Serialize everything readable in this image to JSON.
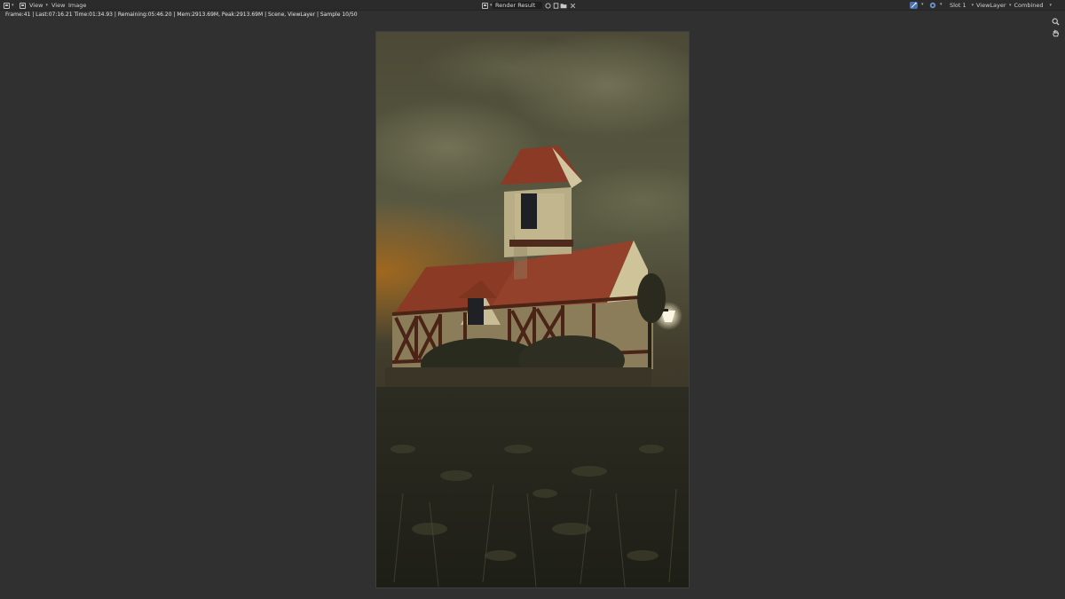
{
  "header": {
    "menus": [
      "View",
      "View",
      "Image"
    ],
    "image_name": "Render Result",
    "slot": "Slot 1",
    "view_layer": "ViewLayer",
    "pass": "Combined"
  },
  "status": {
    "text": "Frame:41 | Last:07:16.21 Time:01:34.93 | Remaining:05:46.20 | Mem:2913.69M, Peak:2913.69M | Scene, ViewLayer | Sample 10/50"
  },
  "icons": {
    "editor_type": "image-editor-icon",
    "zoom": "magnifier-icon",
    "pan": "hand-icon"
  },
  "colors": {
    "background": "#303030",
    "header": "#2b2b2b",
    "accent": "#4772b3"
  }
}
